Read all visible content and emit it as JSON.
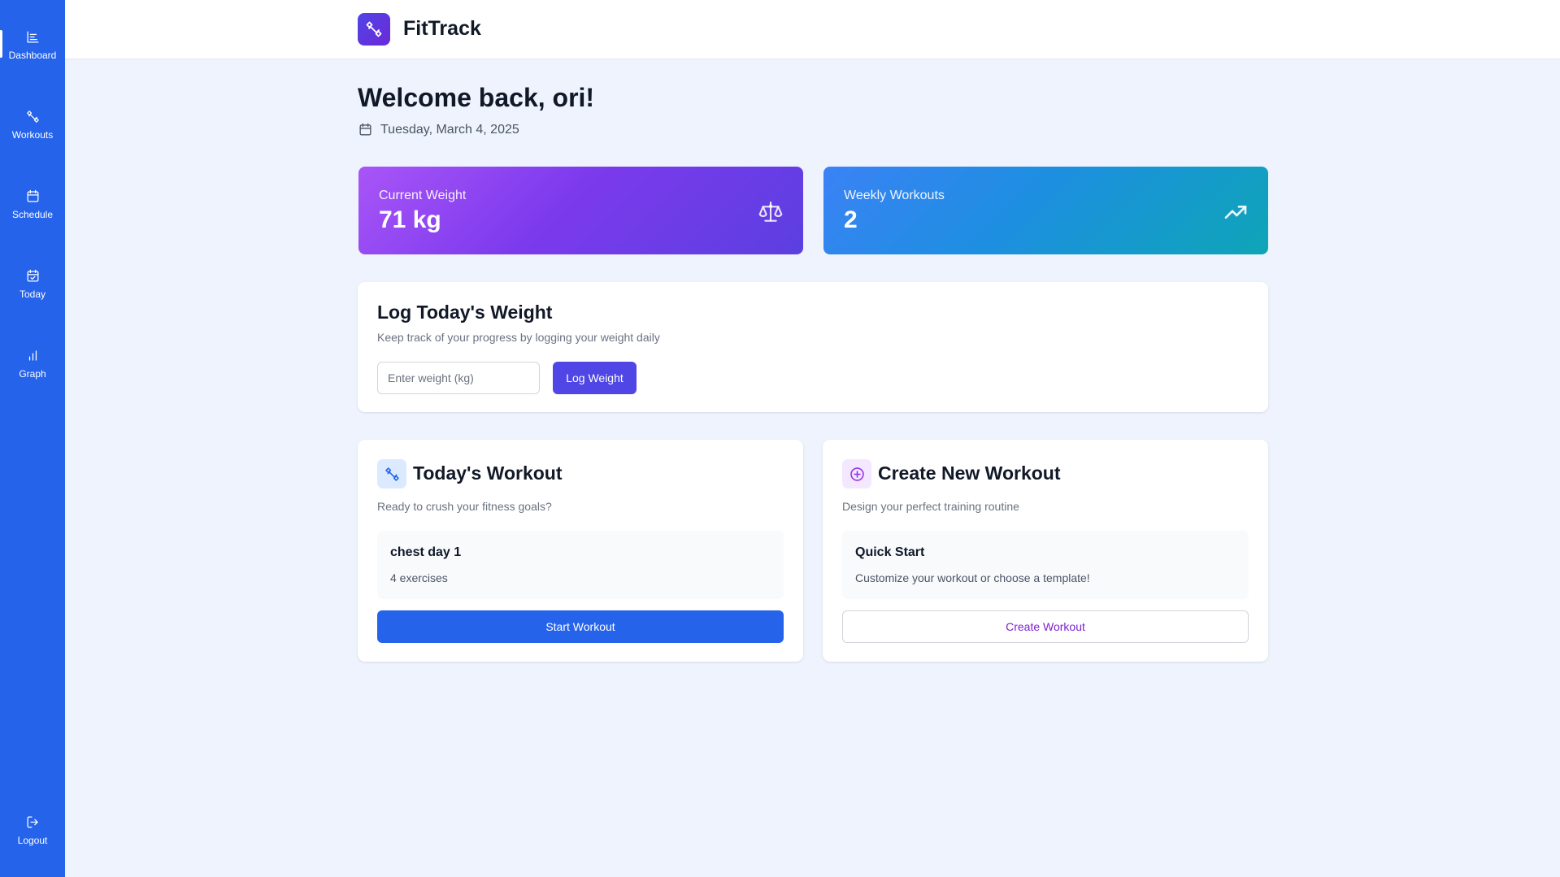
{
  "app": {
    "title": "FitTrack"
  },
  "sidebar": {
    "items": [
      {
        "label": "Dashboard",
        "icon": "dashboard-icon",
        "active": true
      },
      {
        "label": "Workouts",
        "icon": "dumbbell-icon"
      },
      {
        "label": "Schedule",
        "icon": "calendar-icon"
      },
      {
        "label": "Today",
        "icon": "calendar-check-icon"
      },
      {
        "label": "Graph",
        "icon": "bar-chart-icon"
      }
    ],
    "logout": {
      "label": "Logout",
      "icon": "logout-icon"
    }
  },
  "welcome": {
    "heading": "Welcome back, ori!",
    "date": "Tuesday, March 4, 2025"
  },
  "stats": {
    "weight": {
      "label": "Current Weight",
      "value": "71 kg",
      "icon": "scale-icon"
    },
    "weekly": {
      "label": "Weekly Workouts",
      "value": "2",
      "icon": "trending-up-icon"
    }
  },
  "log_weight": {
    "title": "Log Today's Weight",
    "subtitle": "Keep track of your progress by logging your weight daily",
    "input_value": "",
    "input_placeholder": "Enter weight (kg)",
    "button_label": "Log Weight"
  },
  "todays_workout": {
    "title": "Today's Workout",
    "subtitle": "Ready to crush your fitness goals?",
    "workout_name": "chest day 1",
    "exercise_count": "4 exercises",
    "button_label": "Start Workout"
  },
  "create_workout": {
    "title": "Create New Workout",
    "subtitle": "Design your perfect training routine",
    "box_title": "Quick Start",
    "box_text": "Customize your workout or choose a template!",
    "button_label": "Create Workout"
  },
  "colors": {
    "sidebar": "#2563eb",
    "primary": "#4f46e5",
    "weight_card": "#8b5cf6",
    "weekly_card": "#0ea5b7",
    "create_accent": "#7e22ce"
  }
}
